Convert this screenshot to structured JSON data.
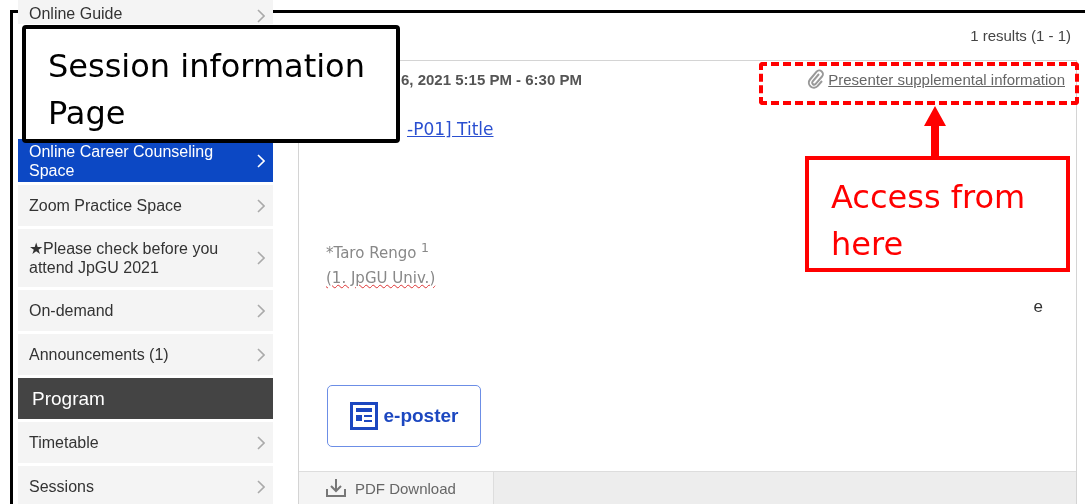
{
  "sidebar": {
    "items": [
      {
        "label": "Online Guide",
        "kind": "item",
        "selected": false
      },
      {
        "label": "Online Career Counseling Space",
        "kind": "item",
        "selected": true
      },
      {
        "label": "Zoom Practice Space",
        "kind": "item",
        "selected": false
      },
      {
        "label": "★Please check before you attend JpGU 2021",
        "kind": "item",
        "selected": false
      },
      {
        "label": "On-demand",
        "kind": "item",
        "selected": false
      },
      {
        "label": "Announcements (1)",
        "kind": "item",
        "selected": false
      },
      {
        "label": "Program",
        "kind": "header"
      },
      {
        "label": "Timetable",
        "kind": "item",
        "selected": false
      },
      {
        "label": "Sessions",
        "kind": "item",
        "selected": false
      }
    ]
  },
  "results": "1 results (1 - 1)",
  "session": {
    "date": "6, 2021 5:15 PM - 6:30 PM",
    "supplement_link": "Presenter supplemental information",
    "title": "-P01] Title",
    "author": "*Taro Rengo $^{1}$",
    "affiliation": "(1. JpGU Univ.)",
    "fragment": "e",
    "eposter_button": "e-poster",
    "pdf_download": "PDF Download"
  },
  "annotations": [
    {
      "text": "Session information Page",
      "kind": "label"
    },
    {
      "text": "Access from here",
      "kind": "callout"
    }
  ]
}
